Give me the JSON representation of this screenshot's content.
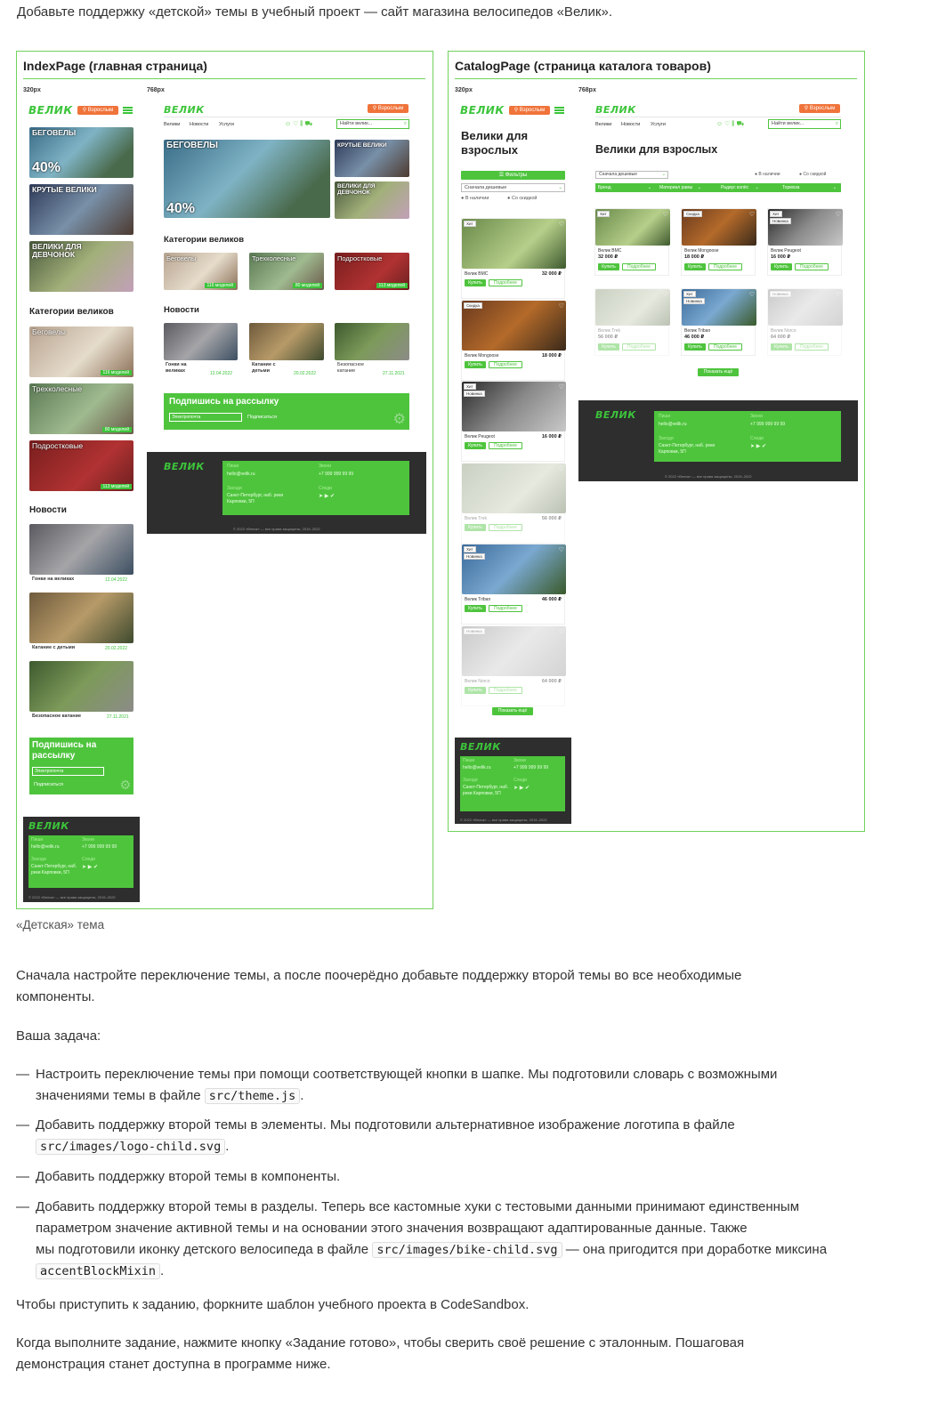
{
  "intro": "Добавьте поддержку «детской» темы в учебный проект — сайт магазина велосипедов «Велик».",
  "colors": {
    "accent": "#4ec43d",
    "orange": "#f0733a",
    "dark": "#2e2e2e"
  },
  "index_frame": {
    "title": "IndexPage (главная страница)",
    "bp320": "320px",
    "bp768": "768px"
  },
  "catalog_frame": {
    "title": "CatalogPage (страница каталога товаров)",
    "bp320": "320px",
    "bp768": "768px"
  },
  "brand": {
    "logo": "ВЕЛИК",
    "adults": "Взрослым",
    "search_placeholder": "Найти велик..."
  },
  "nav": [
    "Велики",
    "Новости",
    "Услуги"
  ],
  "promo": {
    "label": "БЕГОВЕЛЫ",
    "discount": "40%",
    "tile2": "КРУТЫЕ ВЕЛИКИ",
    "tile3": "ВЕЛИКИ ДЛЯ ДЕВЧОНОК"
  },
  "categories": {
    "title": "Категории великов",
    "items": [
      {
        "name": "Беговелы",
        "count": "116 моделей"
      },
      {
        "name": "Трехколесные",
        "count": "80 моделей"
      },
      {
        "name": "Подростковые",
        "count": "113 моделей"
      }
    ]
  },
  "news": {
    "title": "Новости",
    "items": [
      {
        "name": "Гонки на великах",
        "date": "12.04.2022"
      },
      {
        "name": "Катание с детьми",
        "date": "20.02.2022"
      },
      {
        "name": "Безопасное катание",
        "date": "27.11.2021"
      }
    ]
  },
  "subscribe": {
    "title": "Подпишись на рассылку",
    "placeholder": "Электропочта",
    "button": "Подписаться"
  },
  "footer": {
    "write": "Пиши",
    "email": "hello@velik.ru",
    "call": "Звони",
    "phone": "+7 999 999 99 99",
    "visit": "Заходи",
    "address": "Санкт-Петербург, наб. реки Карповки, 5П",
    "follow": "Следи",
    "copyright": "© 2022 «Велик» — все права защищены, 2019–2022"
  },
  "catalog": {
    "title": "Велики для взрослых",
    "filters": "Фильтры",
    "sort": "Сначала дешевые",
    "in_stock": "В наличии",
    "discounted": "Со скидкой",
    "filter_tabs": [
      "Бренд",
      "Материал рамы",
      "Радиус колёс",
      "Тормоза"
    ],
    "buy": "Купить",
    "more": "Подробнее",
    "show_more": "Показать ещё",
    "products": [
      {
        "name": "Велик BMC",
        "price": "32 000 ₽",
        "tags": [
          "Хит"
        ],
        "faded": false
      },
      {
        "name": "Велик Mongoose",
        "price": "18 000 ₽",
        "tags": [
          "Скидка"
        ],
        "faded": false
      },
      {
        "name": "Велик Peugeot",
        "price": "16 000 ₽",
        "tags": [
          "Хит",
          "Новинка"
        ],
        "faded": false
      },
      {
        "name": "Велик Trek",
        "price": "56 000 ₽",
        "tags": [],
        "faded": true
      },
      {
        "name": "Велик Triban",
        "price": "46 000 ₽",
        "tags": [
          "Хит",
          "Новинка"
        ],
        "faded": false
      },
      {
        "name": "Велик Norco",
        "price": "64 000 ₽",
        "tags": [
          "Новинка"
        ],
        "faded": true
      }
    ]
  },
  "caption": "«Детская» тема",
  "p1": "Сначала настройте переключение темы, а после поочерёдно добавьте поддержку второй темы во все необходимые компоненты.",
  "task_label": "Ваша задача:",
  "tasks": {
    "t1a": "Настроить переключение темы при помощи соответствующей кнопки в шапке. Мы подготовили словарь с возможными",
    "t1b": "значениями темы в файле",
    "t1code": "src/theme.js",
    "t1end": ".",
    "t2a": "Добавить поддержку второй темы в элементы. Мы подготовили альтернативное изображение логотипа в файле",
    "t2code": "src/images/logo-child.svg",
    "t2end": ".",
    "t3": "Добавить поддержку второй темы в компоненты.",
    "t4a": "Добавить поддержку второй темы в разделы. Теперь все кастомные хуки с тестовыми данными принимают единственным",
    "t4b": "параметром значение активной темы и на основании этого значения возвращают адаптированные данные. Также",
    "t4c": "мы подготовили иконку детского велосипеда в файле",
    "t4code": "src/images/bike-child.svg",
    "t4d": "— она пригодится при доработке миксина",
    "t4code2": "accentBlockMixin",
    "t4end": "."
  },
  "p_fork": "Чтобы приступить к заданию, форкните шаблон учебного проекта в CodeSandbox.",
  "p_done1": "Когда выполните задание, нажмите кнопку «Задание готово», чтобы сверить своё решение с эталонным. Пошаговая",
  "p_done2": "демонстрация станет доступна в программе ниже."
}
